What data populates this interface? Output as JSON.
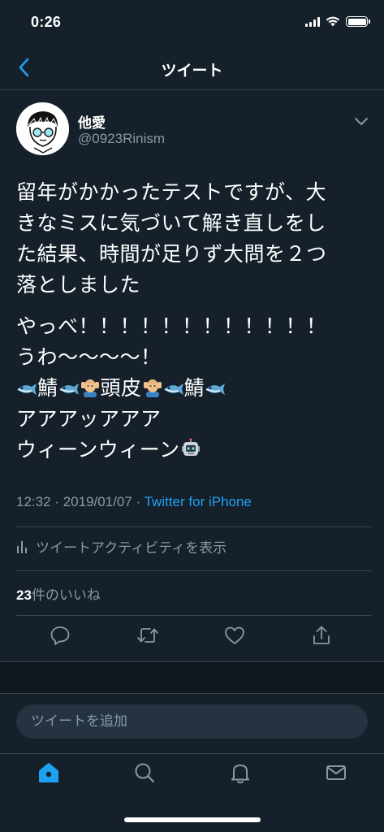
{
  "status_bar": {
    "time": "0:26"
  },
  "nav": {
    "title": "ツイート"
  },
  "tweet": {
    "display_name": "他愛",
    "handle": "@0923Rinism",
    "text_lines_1": [
      "留年がかかったテストですが、大",
      "きなミスに気づいて解き直しをし",
      "た結果、時間が足りず大問を２つ",
      "落としました"
    ],
    "text_line_2a": "やっべ！！！！！！！！！！！！",
    "text_line_2b": "うわ〜〜〜〜！",
    "text_line_2c_parts": [
      "鯖",
      "頭皮",
      "鯖"
    ],
    "text_line_2d": "アアアッアアア",
    "text_line_2e": "ウィーンウィーン",
    "time": "12:32",
    "date": "2019/01/07",
    "separator": "·",
    "source": "Twitter for iPhone",
    "activity_label": "ツイートアクティビティを表示",
    "likes_count": "23",
    "likes_label": "件のいいね"
  },
  "compose": {
    "placeholder": "ツイートを追加"
  },
  "colors": {
    "background": "#15202b",
    "accent": "#1da1f2",
    "secondary_text": "#8899a6",
    "border": "#38444d"
  }
}
